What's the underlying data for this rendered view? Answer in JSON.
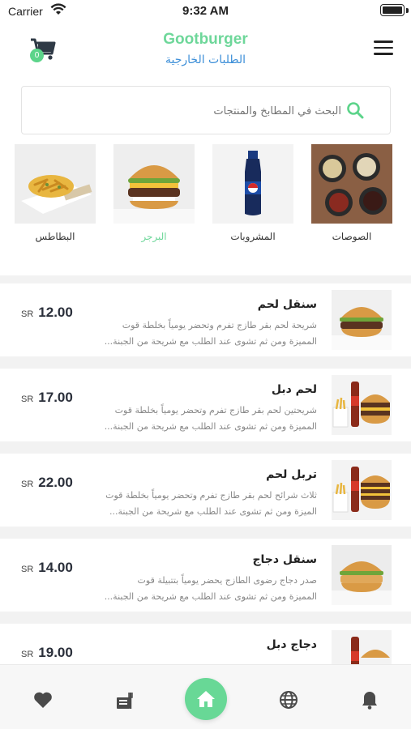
{
  "status_bar": {
    "carrier": "Carrier",
    "time": "9:32 AM"
  },
  "header": {
    "brand": "Gootburger",
    "subtitle": "الطلبات الخارجية",
    "cart_count": "0"
  },
  "search": {
    "placeholder": "البحث في المطابخ والمنتجات"
  },
  "categories": [
    {
      "label": "البطاطس",
      "image": "fries-image"
    },
    {
      "label": "البرجر",
      "image": "burger-image",
      "active": true
    },
    {
      "label": "المشروبات",
      "image": "drinks-image"
    },
    {
      "label": "الصوصات",
      "image": "sauces-image"
    }
  ],
  "items": [
    {
      "title": "سنقل لحم",
      "desc1": "شريحة لحم بقر طازج تفرم وتحضر يومياً بخلطة قوت",
      "desc2": "المميزة ومن ثم تشوى عند الطلب مع شريحة من الجبنة...",
      "price": "12.00",
      "currency": "SR"
    },
    {
      "title": "لحم دبل",
      "desc1": "شريحتين لحم بقر طازج تفرم وتحضر يومياً بخلطة قوت",
      "desc2": "المميزة ومن ثم تشوى عند الطلب مع شريحة من الجبنة...",
      "price": "17.00",
      "currency": "SR"
    },
    {
      "title": "تربل لحم",
      "desc1": "ثلاث شرائح لحم بقر طازج تفرم وتحضر يومياً بخلطة قوت",
      "desc2": "الميزة ومن ثم تشوى عند الطلب مع شريحة من الجبنة...",
      "price": "22.00",
      "currency": "SR"
    },
    {
      "title": "سنقل دجاج",
      "desc1": "صدر دجاج رضوى الطازج يحضر يومياً بتتبيلة قوت",
      "desc2": "المميزة ومن ثم تشوى عند الطلب مع شريحة من الجبنة...",
      "price": "14.00",
      "currency": "SR"
    },
    {
      "title": "دجاج دبل",
      "desc1": "",
      "desc2": "",
      "price": "19.00",
      "currency": "SR"
    }
  ],
  "colors": {
    "accent": "#6ed79a",
    "subtitle": "#3d8fd8",
    "price": "#2a2f3a"
  },
  "tabbar": [
    "heart-icon",
    "menu-food-icon",
    "home-icon",
    "globe-icon",
    "bell-icon"
  ]
}
